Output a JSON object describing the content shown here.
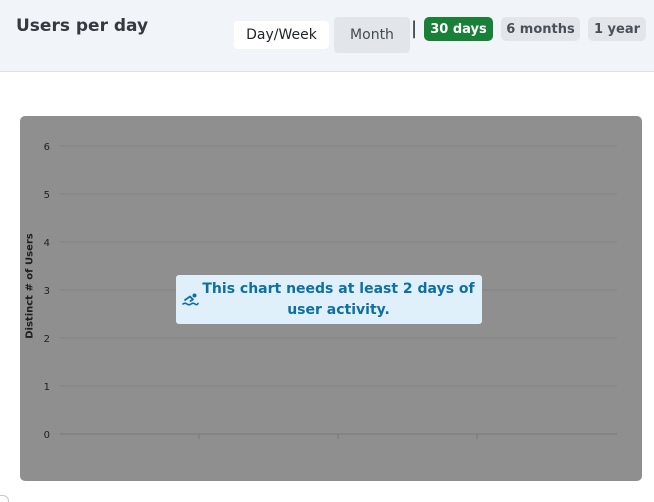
{
  "header": {
    "title": "Users per day",
    "segments": [
      "Day/Week",
      "Month"
    ],
    "selected_segment": "Day/Week",
    "separator": "|",
    "ranges": [
      "30 days",
      "6 months",
      "1 year"
    ],
    "selected_range": "30 days"
  },
  "colors": {
    "header_bg": "#f1f4f8",
    "active_range": "#198038",
    "chart_bg": "#8f8f8f",
    "notice_bg": "#dff0fa",
    "notice_text": "#0f6fa3"
  },
  "chart_data": {
    "type": "line",
    "ylabel": "Distinct # of Users",
    "xlabel": "",
    "ylim": [
      0,
      6
    ],
    "yticks": [
      "0",
      "1",
      "2",
      "3",
      "4",
      "5",
      "6"
    ],
    "grid": true,
    "series": []
  },
  "notice": {
    "icon": "swimmer-icon",
    "text": "This chart needs at least 2 days of user activity."
  }
}
